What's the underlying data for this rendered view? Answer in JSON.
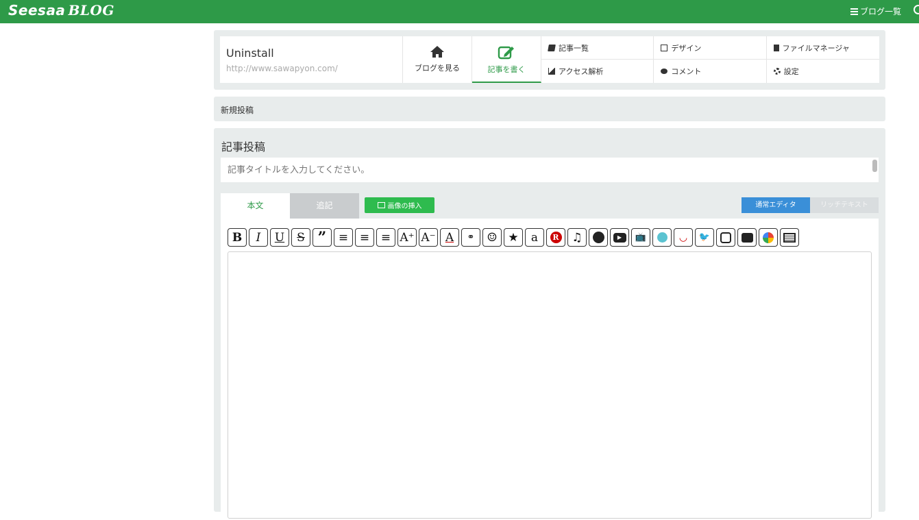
{
  "topbar": {
    "logo_main": "Seesaa",
    "logo_blog": "BLOG",
    "nav_label": "ブログ一覧"
  },
  "site": {
    "title": "Uninstall",
    "url": "http://www.sawapyon.com/"
  },
  "header_tabs": {
    "view_blog": "ブログを見る",
    "write_post": "記事を書く"
  },
  "menu": [
    "記事一覧",
    "デザイン",
    "ファイルマネージャ",
    "アクセス解析",
    "コメント",
    "設定"
  ],
  "breadcrumb": "新規投稿",
  "editor": {
    "heading": "記事投稿",
    "title_placeholder": "記事タイトルを入力してください。",
    "tab_body": "本文",
    "tab_append": "追記",
    "insert_image": "画像の挿入",
    "mode_normal": "通常エディタ",
    "mode_rich": "リッチテキスト"
  },
  "toolbar_buttons": [
    "bold",
    "italic",
    "underline",
    "strikethrough",
    "quote",
    "align-left",
    "align-center",
    "align-right",
    "font-bigger",
    "font-smaller",
    "font-color",
    "link",
    "emoji",
    "star",
    "amazon",
    "rakuten",
    "music",
    "globe",
    "youtube",
    "tv",
    "niconico",
    "smile",
    "twitter",
    "instagram",
    "flickr",
    "photos",
    "table"
  ],
  "colors": {
    "brand_green": "#2e9a48",
    "button_green": "#2ebb4e",
    "button_blue": "#3a8fd8"
  }
}
